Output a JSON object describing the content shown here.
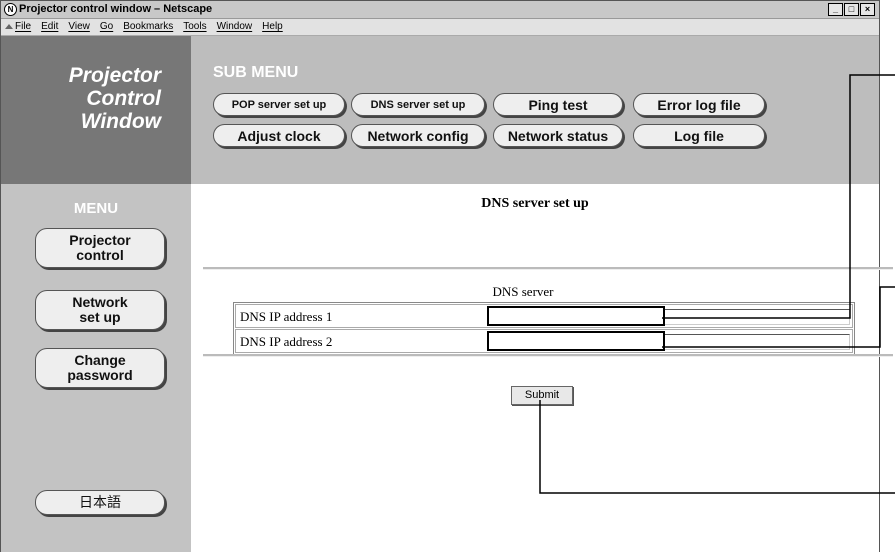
{
  "window": {
    "title": "Projector control window – Netscape",
    "title_icon": "netscape-icon",
    "controls": {
      "minimize": "_",
      "maximize": "□",
      "close": "×"
    }
  },
  "menubar": {
    "items": [
      "File",
      "Edit",
      "View",
      "Go",
      "Bookmarks",
      "Tools",
      "Window",
      "Help"
    ]
  },
  "logo": {
    "line1": "Projector",
    "line2": "Control",
    "line3": "Window"
  },
  "submenu": {
    "title": "SUB MENU",
    "buttons": {
      "pop": "POP server set up",
      "dns": "DNS server set up",
      "ping": "Ping test",
      "errorlog": "Error log file",
      "clock": "Adjust clock",
      "netconfig": "Network config",
      "netstatus": "Network status",
      "log": "Log file"
    }
  },
  "menu": {
    "title": "MENU",
    "projector_line1": "Projector",
    "projector_line2": "control",
    "network_line1": "Network",
    "network_line2": "set up",
    "password_line1": "Change",
    "password_line2": "password",
    "japanese": "日本語"
  },
  "main": {
    "title": "DNS server set up",
    "section": "DNS server",
    "fields": {
      "dns1_label": "DNS IP address 1",
      "dns1_value": "",
      "dns2_label": "DNS IP address 2",
      "dns2_value": ""
    },
    "submit": "Submit"
  },
  "colors": {
    "logo_bg": "#777777",
    "submenu_bg": "#bdbdbd",
    "sidebar_bg": "#c3c3c3",
    "button_bg": "#eeeeee"
  }
}
